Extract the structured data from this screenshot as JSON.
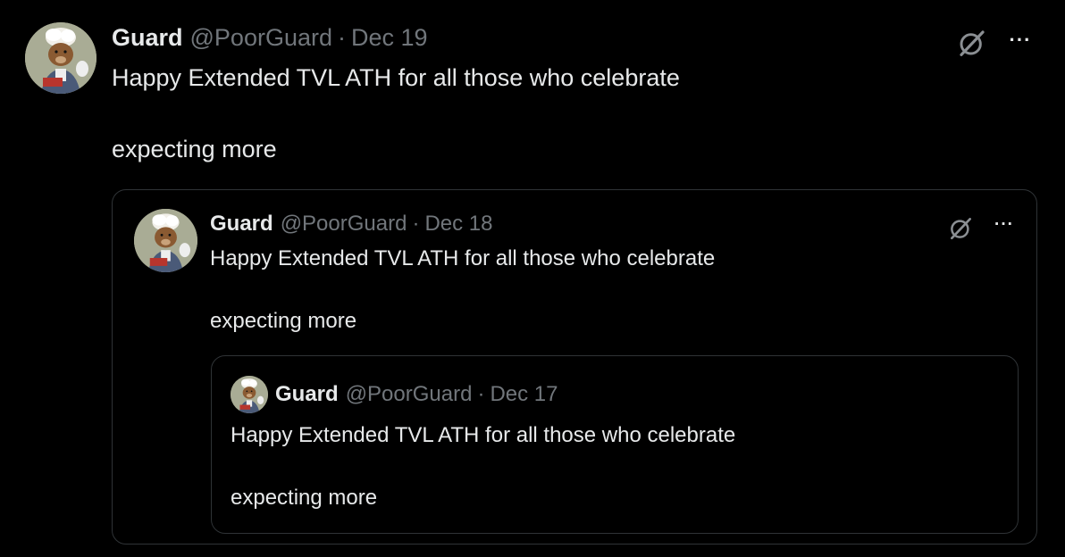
{
  "tweet": {
    "name": "Guard",
    "handle": "@PoorGuard",
    "separator": "·",
    "date": "Dec 19",
    "line1": "Happy Extended TVL ATH for all those who celebrate",
    "line2": "expecting more",
    "more_label": "···",
    "grok_icon": "grok-icon",
    "avatar_icon": "bear-avatar"
  },
  "quote1": {
    "name": "Guard",
    "handle": "@PoorGuard",
    "separator": "·",
    "date": "Dec 18",
    "line1": "Happy Extended TVL ATH for all those who celebrate",
    "line2": "expecting more",
    "more_label": "···",
    "grok_icon": "grok-icon",
    "avatar_icon": "bear-avatar"
  },
  "quote2": {
    "name": "Guard",
    "handle": "@PoorGuard",
    "separator": "·",
    "date": "Dec 17",
    "line1": "Happy Extended TVL ATH for all those who celebrate",
    "line2": "expecting more",
    "avatar_icon": "bear-avatar"
  },
  "colors": {
    "background": "#000000",
    "text": "#e7e9ea",
    "secondary": "#71767b",
    "border": "#2f3336"
  }
}
